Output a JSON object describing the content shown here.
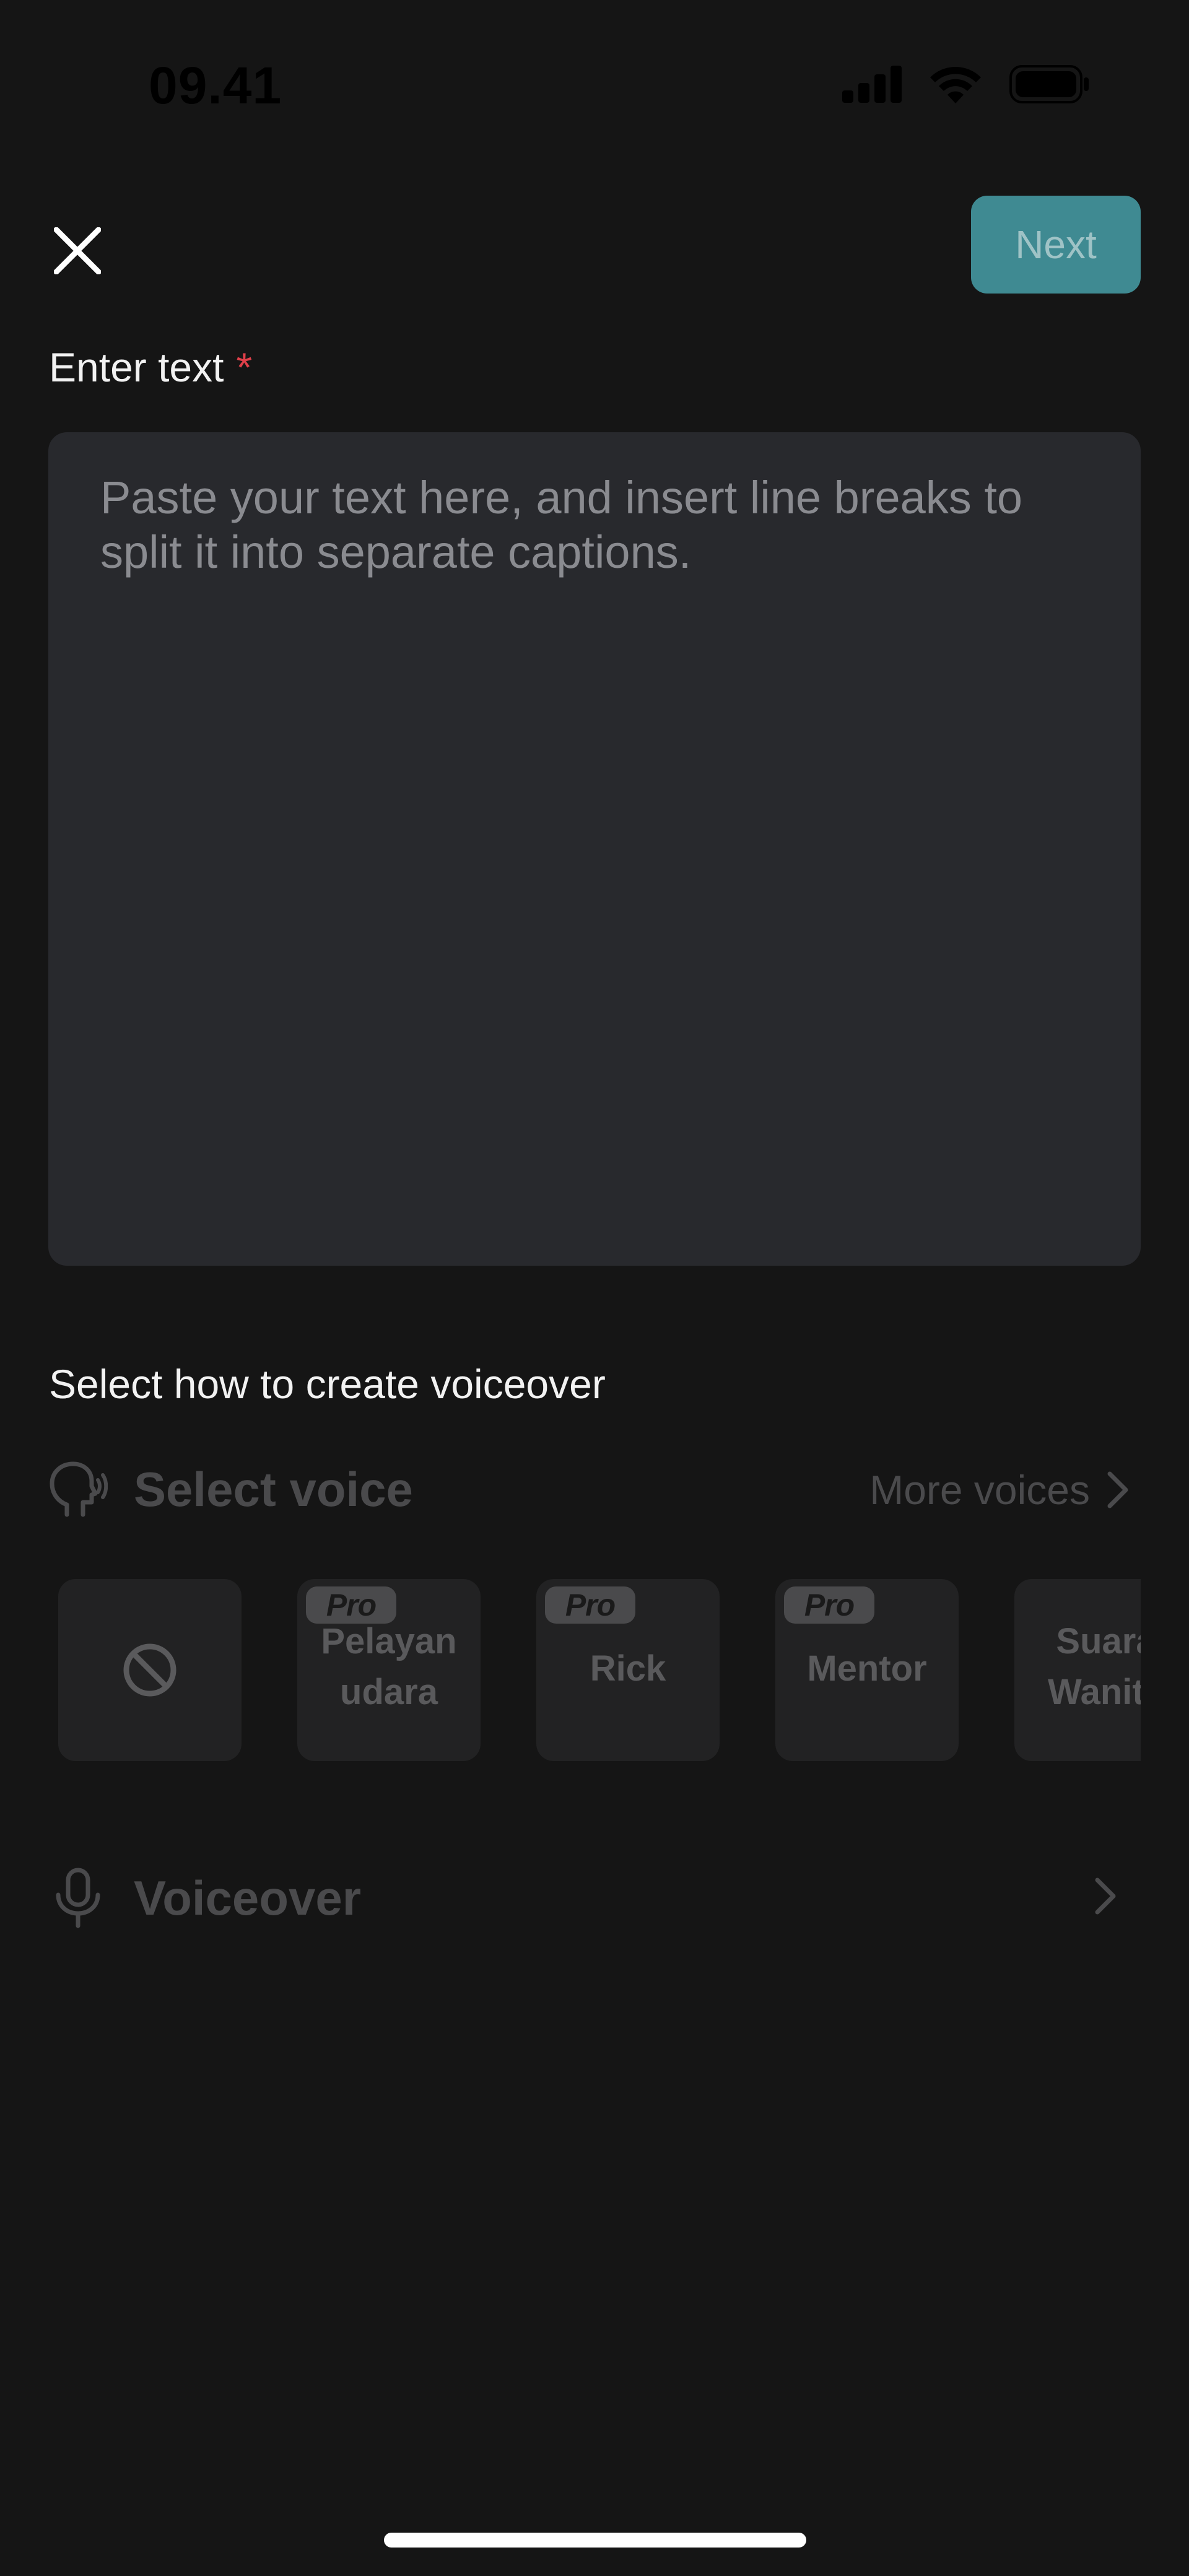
{
  "status_bar": {
    "time": "09.41"
  },
  "header": {
    "next_label": "Next"
  },
  "enter_text": {
    "label": "Enter text",
    "required_mark": "*",
    "placeholder": "Paste your text here, and insert line breaks to split it into separate captions."
  },
  "voiceover_section": {
    "label": "Select how to create voiceover",
    "select_voice_label": "Select voice",
    "more_voices_label": "More voices",
    "voices": [
      {
        "name": "",
        "pro": false,
        "kind": "none"
      },
      {
        "name": "Pelayan udara",
        "line1": "Pelayan",
        "line2": "udara",
        "pro": true,
        "pro_label": "Pro"
      },
      {
        "name": "Rick",
        "pro": true,
        "pro_label": "Pro"
      },
      {
        "name": "Mentor",
        "pro": true,
        "pro_label": "Pro"
      },
      {
        "name": "Suara Wanita",
        "line1": "Suara",
        "line2": "Wanita",
        "pro": false
      }
    ],
    "voiceover_label": "Voiceover"
  },
  "colors": {
    "background": "#151515",
    "next_button": "#3f8a92",
    "required": "#e0404a",
    "text_area": "#28292d"
  }
}
